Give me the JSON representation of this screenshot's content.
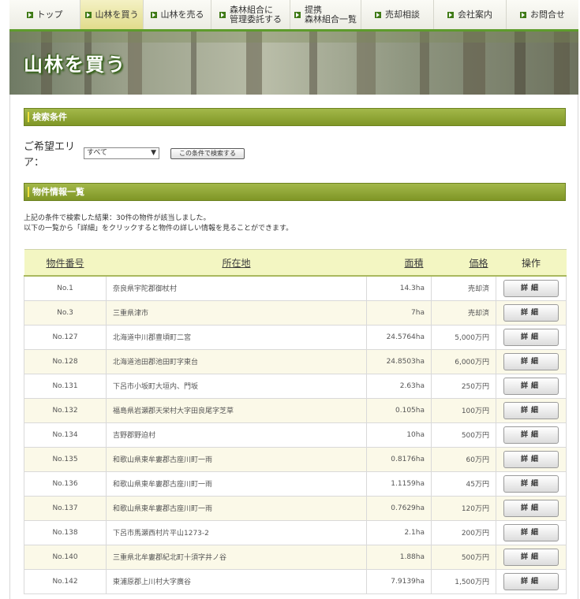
{
  "nav": [
    {
      "label": "トップ",
      "active": false
    },
    {
      "label": "山林を買う",
      "active": true
    },
    {
      "label": "山林を売る",
      "active": false
    },
    {
      "label": "森林組合に\n管理委託する",
      "active": false
    },
    {
      "label": "提携\n森林組合一覧",
      "active": false
    },
    {
      "label": "売却相談",
      "active": false
    },
    {
      "label": "会社案内",
      "active": false
    },
    {
      "label": "お問合せ",
      "active": false
    }
  ],
  "banner": {
    "title": "山林を買う"
  },
  "search": {
    "heading": "検索条件",
    "area_label": "ご希望エリア：",
    "area_selected": "すべて",
    "submit_label": "この条件で検索する"
  },
  "list": {
    "heading": "物件情報一覧",
    "result_line1": "上記の条件で検索した結果：30件の物件が該当しました。",
    "result_line2": "以下の一覧から「詳細」をクリックすると物件の詳しい情報を見ることができます。",
    "columns": [
      "物件番号",
      "所在地",
      "面積",
      "価格",
      "操作"
    ],
    "detail_label": "詳細",
    "rows": [
      {
        "no": "No.1",
        "location": "奈良県宇陀郡御杖村",
        "area": "14.3ha",
        "price": "売却済"
      },
      {
        "no": "No.3",
        "location": "三重県津市",
        "area": "7ha",
        "price": "売却済"
      },
      {
        "no": "No.127",
        "location": "北海道中川郡豊頃町二宮",
        "area": "24.5764ha",
        "price": "5,000万円"
      },
      {
        "no": "No.128",
        "location": "北海道池田郡池田町字東台",
        "area": "24.8503ha",
        "price": "6,000万円"
      },
      {
        "no": "No.131",
        "location": "下呂市小坂町大垣内、門坂",
        "area": "2.63ha",
        "price": "250万円"
      },
      {
        "no": "No.132",
        "location": "福島県岩瀬郡天栄村大字田良尾字芝草",
        "area": "0.105ha",
        "price": "100万円"
      },
      {
        "no": "No.134",
        "location": "吉野郡野迫村",
        "area": "10ha",
        "price": "500万円"
      },
      {
        "no": "No.135",
        "location": "和歌山県東牟婁郡古座川町一雨",
        "area": "0.8176ha",
        "price": "60万円"
      },
      {
        "no": "No.136",
        "location": "和歌山県東牟婁郡古座川町一雨",
        "area": "1.1159ha",
        "price": "45万円"
      },
      {
        "no": "No.137",
        "location": "和歌山県東牟婁郡古座川町一雨",
        "area": "0.7629ha",
        "price": "120万円"
      },
      {
        "no": "No.138",
        "location": "下呂市馬瀬西村片平山1273-2",
        "area": "2.1ha",
        "price": "200万円"
      },
      {
        "no": "No.140",
        "location": "三重県北牟婁郡紀北町十須字井ノ谷",
        "area": "1.88ha",
        "price": "500万円"
      },
      {
        "no": "No.142",
        "location": "東浦原郡上川村大字廣谷",
        "area": "7.9139ha",
        "price": "1,500万円"
      }
    ]
  }
}
